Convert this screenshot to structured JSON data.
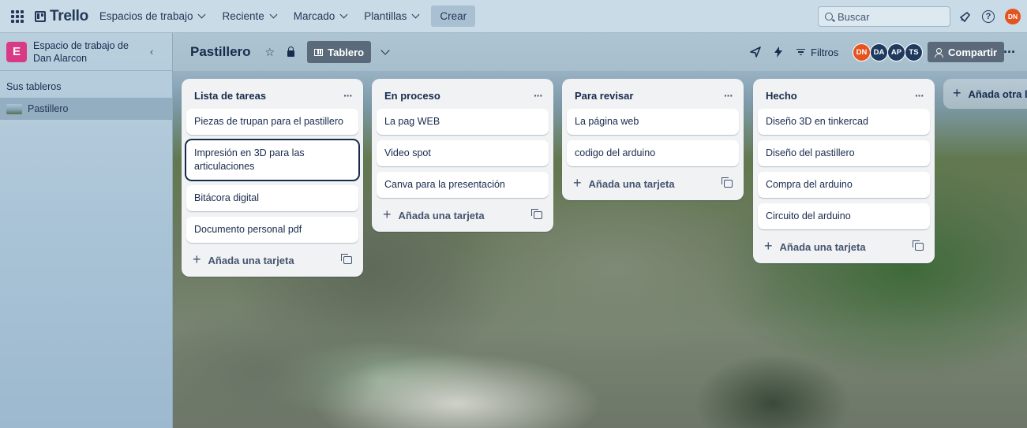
{
  "topbar": {
    "logo": "Trello",
    "nav": [
      {
        "label": "Espacios de trabajo"
      },
      {
        "label": "Reciente"
      },
      {
        "label": "Marcado"
      },
      {
        "label": "Plantillas"
      }
    ],
    "create": "Crear",
    "search_placeholder": "Buscar",
    "user_initials": "DN",
    "user_color": "#e5531f"
  },
  "sidebar": {
    "workspace_initial": "E",
    "workspace_name": "Espacio de trabajo de Dan Alarcon",
    "workspace_color": "#d93a86",
    "boards_heading": "Sus tableros",
    "boards": [
      {
        "label": "Pastillero"
      }
    ]
  },
  "board": {
    "title": "Pastillero",
    "view_label": "Tablero",
    "filters_label": "Filtros",
    "share_label": "Compartir",
    "members": [
      {
        "initials": "DN",
        "color": "#e5531f"
      },
      {
        "initials": "DA",
        "color": "#1f3a5f"
      },
      {
        "initials": "AP",
        "color": "#1f3a5f"
      },
      {
        "initials": "TS",
        "color": "#1f3a5f"
      }
    ],
    "add_list_label": "Añada otra lista",
    "add_card_label": "Añada una tarjeta",
    "lists": [
      {
        "title": "Lista de tareas",
        "cards": [
          {
            "text": "Piezas de trupan para el pastillero"
          },
          {
            "text": "Impresión en 3D para las articulaciones"
          },
          {
            "text": "Bitácora digital"
          },
          {
            "text": "Documento personal pdf"
          }
        ]
      },
      {
        "title": "En proceso",
        "cards": [
          {
            "text": "La pag WEB"
          },
          {
            "text": "Video spot"
          },
          {
            "text": "Canva para la presentación"
          }
        ]
      },
      {
        "title": "Para revisar",
        "cards": [
          {
            "text": "La página web"
          },
          {
            "text": "codigo del arduino"
          }
        ]
      },
      {
        "title": "Hecho",
        "cards": [
          {
            "text": "Diseño 3D en tinkercad"
          },
          {
            "text": "Diseño del pastillero"
          },
          {
            "text": "Compra del arduino"
          },
          {
            "text": "Circuito del arduino"
          }
        ]
      }
    ]
  }
}
